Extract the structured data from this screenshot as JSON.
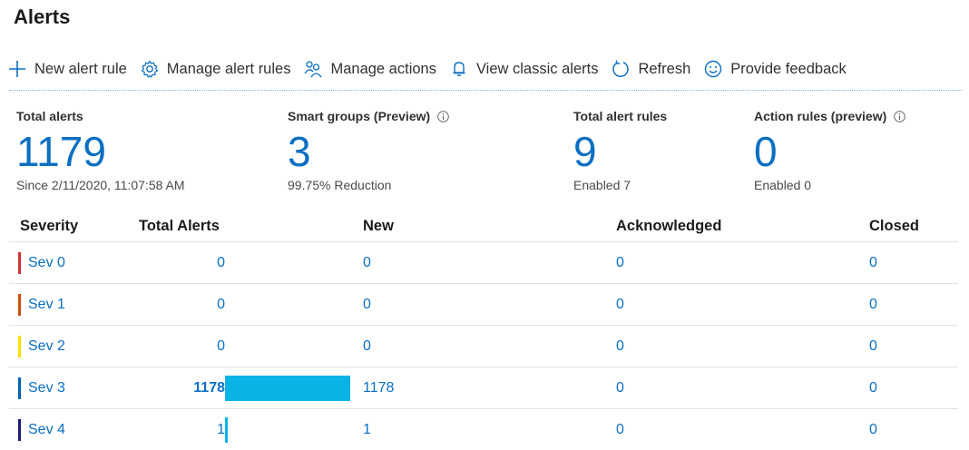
{
  "page": {
    "title": "Alerts"
  },
  "toolbar": {
    "items": [
      {
        "label": "New alert rule",
        "icon": "plus-icon"
      },
      {
        "label": "Manage alert rules",
        "icon": "gear-icon"
      },
      {
        "label": "Manage actions",
        "icon": "people-icon"
      },
      {
        "label": "View classic alerts",
        "icon": "bell-icon"
      },
      {
        "label": "Refresh",
        "icon": "refresh-icon"
      },
      {
        "label": "Provide feedback",
        "icon": "smiley-icon"
      }
    ]
  },
  "cards": {
    "total_alerts": {
      "label": "Total alerts",
      "value": "1179",
      "sub": "Since 2/11/2020, 11:07:58 AM"
    },
    "smart_groups": {
      "label": "Smart groups (Preview)",
      "value": "3",
      "sub": "99.75% Reduction"
    },
    "total_rules": {
      "label": "Total alert rules",
      "value": "9",
      "sub": "Enabled 7"
    },
    "action_rules": {
      "label": "Action rules (preview)",
      "value": "0",
      "sub": "Enabled 0"
    }
  },
  "table": {
    "headers": {
      "severity": "Severity",
      "total": "Total Alerts",
      "new": "New",
      "ack": "Acknowledged",
      "closed": "Closed"
    },
    "rows": [
      {
        "severity": "Sev 0",
        "color": "#d13438",
        "total": "0",
        "total_fraction": 0,
        "new": "0",
        "ack": "0",
        "closed": "0"
      },
      {
        "severity": "Sev 1",
        "color": "#ca5010",
        "total": "0",
        "total_fraction": 0,
        "new": "0",
        "ack": "0",
        "closed": "0"
      },
      {
        "severity": "Sev 2",
        "color": "#fce100",
        "total": "0",
        "total_fraction": 0,
        "new": "0",
        "ack": "0",
        "closed": "0"
      },
      {
        "severity": "Sev 3",
        "color": "#0063b1",
        "total": "1178",
        "total_fraction": 1,
        "new": "1178",
        "ack": "0",
        "closed": "0"
      },
      {
        "severity": "Sev 4",
        "color": "#1d1d7a",
        "total": "1",
        "total_fraction": 0.001,
        "new": "1",
        "ack": "0",
        "closed": "0"
      }
    ]
  },
  "colors": {
    "accent": "#0a6fc2",
    "bar": "#0ab3e6"
  }
}
